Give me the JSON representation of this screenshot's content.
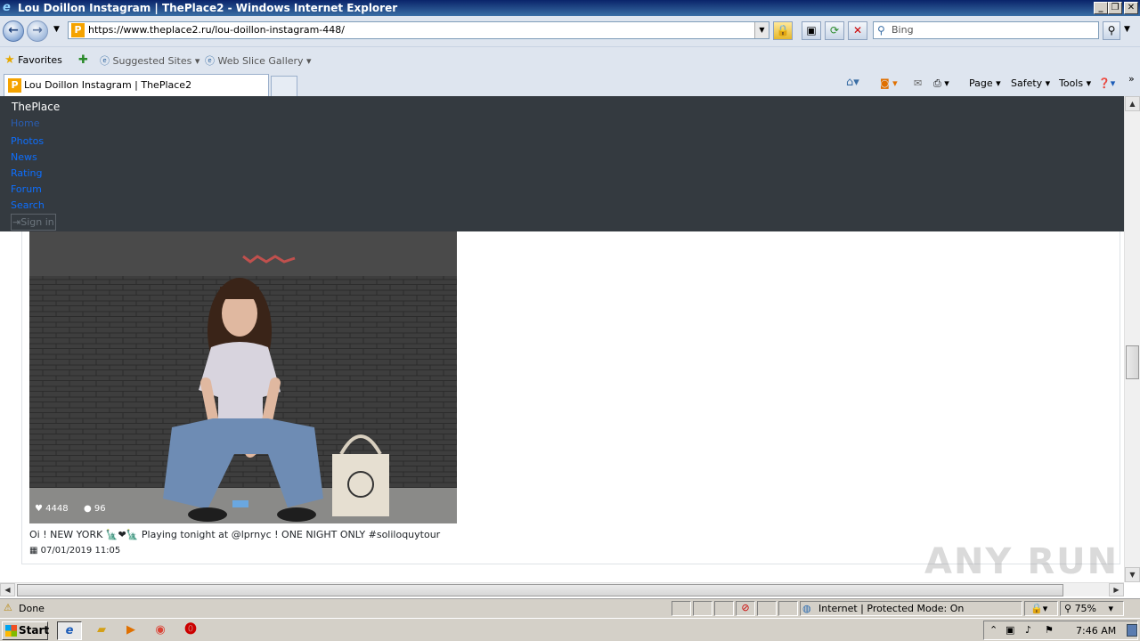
{
  "window": {
    "title": "Lou Doillon Instagram | ThePlace2 - Windows Internet Explorer"
  },
  "toolbar": {
    "url": "https://www.theplace2.ru/lou-doillon-instagram-448/",
    "search_placeholder": "Bing"
  },
  "favorites": {
    "label": "Favorites",
    "items": [
      "Suggested Sites",
      "Web Slice Gallery"
    ]
  },
  "tabs": [
    {
      "label": "Lou Doillon Instagram | ThePlace2"
    }
  ],
  "commands": {
    "page": "Page",
    "safety": "Safety",
    "tools": "Tools"
  },
  "site": {
    "brand": "ThePlace",
    "nav": [
      "Home",
      "Photos",
      "News",
      "Rating",
      "Forum",
      "Search"
    ],
    "signin": "Sign in"
  },
  "post": {
    "likes": "4448",
    "comments": "96",
    "caption": "Oi ! NEW YORK 🗽❤🗽 Playing tonight at @lprnyc ! ONE NIGHT ONLY #soliloquytour",
    "date": "07/01/2019 11:05"
  },
  "status": {
    "text": "Done",
    "zone": "Internet | Protected Mode: On",
    "zoom": "75%"
  },
  "taskbar": {
    "start": "Start",
    "clock": "7:46 AM"
  },
  "watermark": "ANY RUN",
  "colors": {
    "titlebar": "#0a246a",
    "navbar": "#343a40",
    "link": "#0d6efd"
  }
}
